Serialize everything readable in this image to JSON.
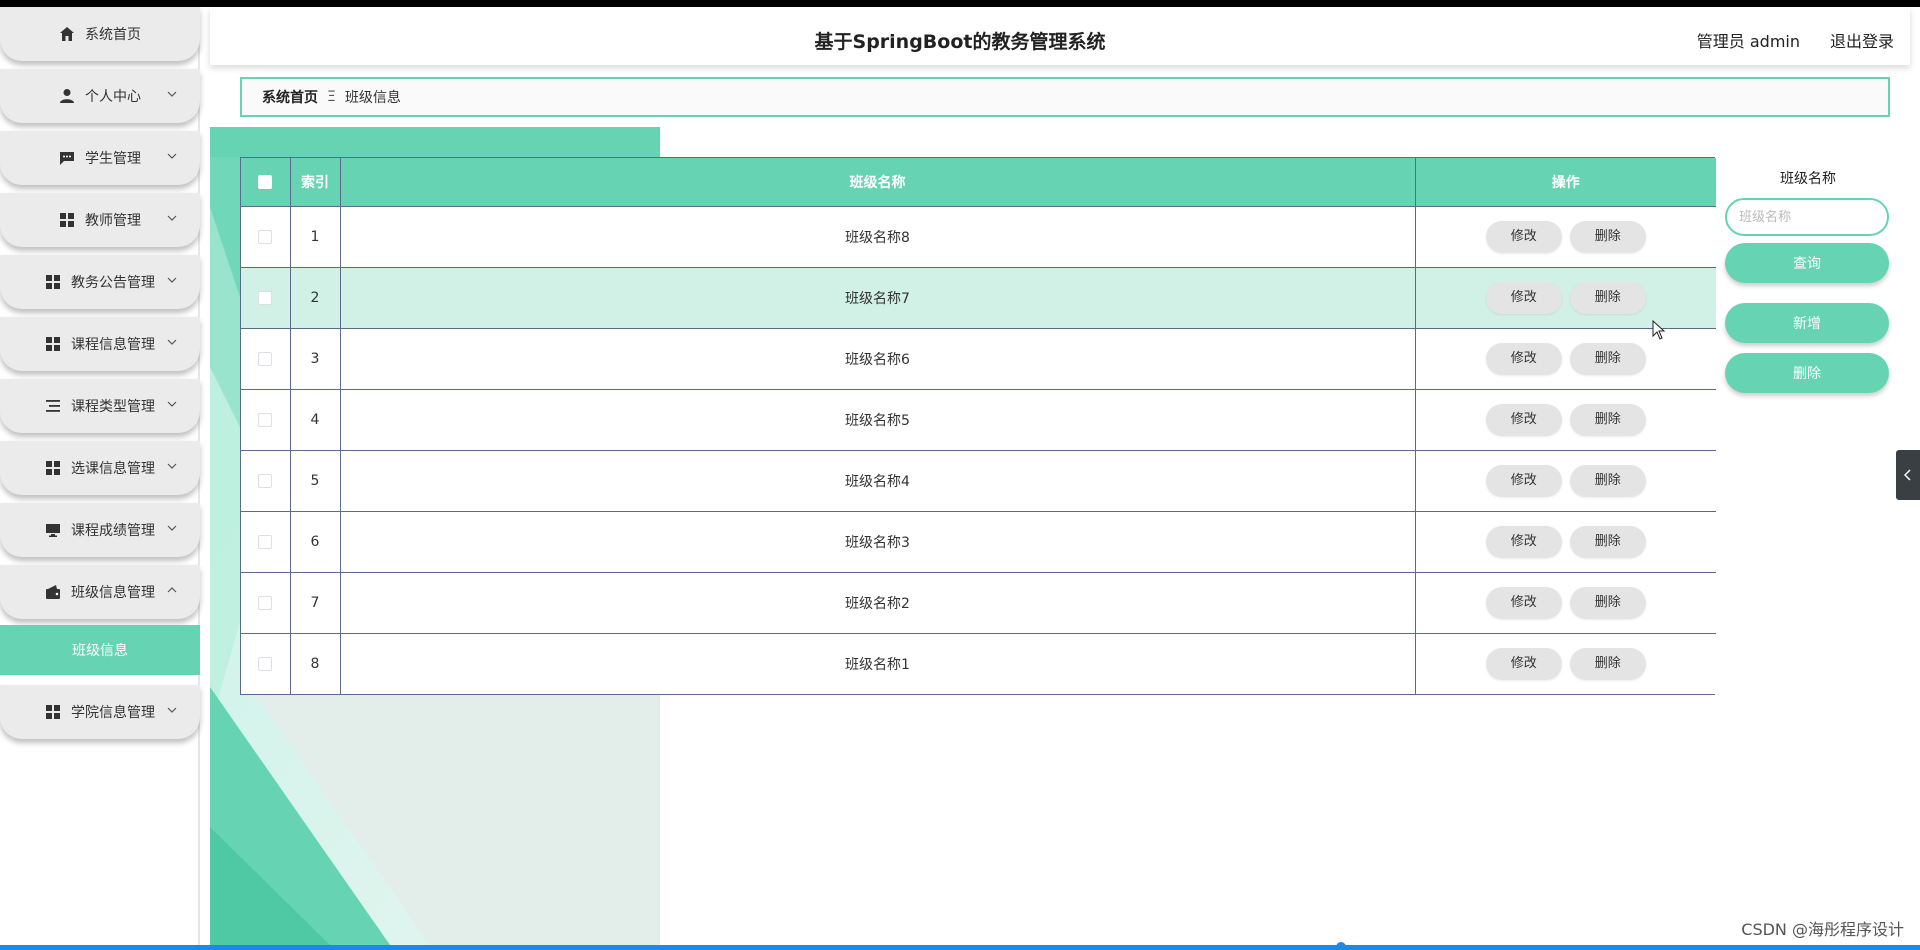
{
  "header": {
    "title": "基于SpringBoot的教务管理系统",
    "user": "管理员 admin",
    "logout": "退出登录"
  },
  "sidebar": {
    "items": [
      {
        "label": "系统首页",
        "icon": "home-icon",
        "expandable": false
      },
      {
        "label": "个人中心",
        "icon": "user-icon",
        "expandable": true
      },
      {
        "label": "学生管理",
        "icon": "chat-icon",
        "expandable": true
      },
      {
        "label": "教师管理",
        "icon": "grid-icon",
        "expandable": true
      },
      {
        "label": "教务公告管理",
        "icon": "grid-icon",
        "expandable": true
      },
      {
        "label": "课程信息管理",
        "icon": "grid-icon",
        "expandable": true
      },
      {
        "label": "课程类型管理",
        "icon": "list-icon",
        "expandable": true
      },
      {
        "label": "选课信息管理",
        "icon": "grid-icon",
        "expandable": true
      },
      {
        "label": "课程成绩管理",
        "icon": "monitor-icon",
        "expandable": true
      },
      {
        "label": "班级信息管理",
        "icon": "wallet-icon",
        "expandable": true,
        "expanded": true
      },
      {
        "label": "学院信息管理",
        "icon": "grid-icon",
        "expandable": true
      }
    ],
    "active_sub": "班级信息"
  },
  "breadcrumb": {
    "home": "系统首页",
    "separator": "Ξ",
    "current": "班级信息"
  },
  "table": {
    "columns": [
      "",
      "索引",
      "班级名称",
      "操作"
    ],
    "rows": [
      {
        "index": "1",
        "name": "班级名称8"
      },
      {
        "index": "2",
        "name": "班级名称7"
      },
      {
        "index": "3",
        "name": "班级名称6"
      },
      {
        "index": "4",
        "name": "班级名称5"
      },
      {
        "index": "5",
        "name": "班级名称4"
      },
      {
        "index": "6",
        "name": "班级名称3"
      },
      {
        "index": "7",
        "name": "班级名称2"
      },
      {
        "index": "8",
        "name": "班级名称1"
      }
    ],
    "highlighted_row": 2,
    "edit_label": "修改",
    "delete_label": "删除"
  },
  "search": {
    "label": "班级名称",
    "placeholder": "班级名称",
    "value": "",
    "query_button": "查询",
    "add_button": "新增",
    "delete_button": "删除"
  },
  "watermark": "CSDN @海彤程序设计",
  "colors": {
    "accent": "#66d4b2",
    "row_highlight": "#d1f0e6",
    "button_gray": "#e4e4e4"
  }
}
